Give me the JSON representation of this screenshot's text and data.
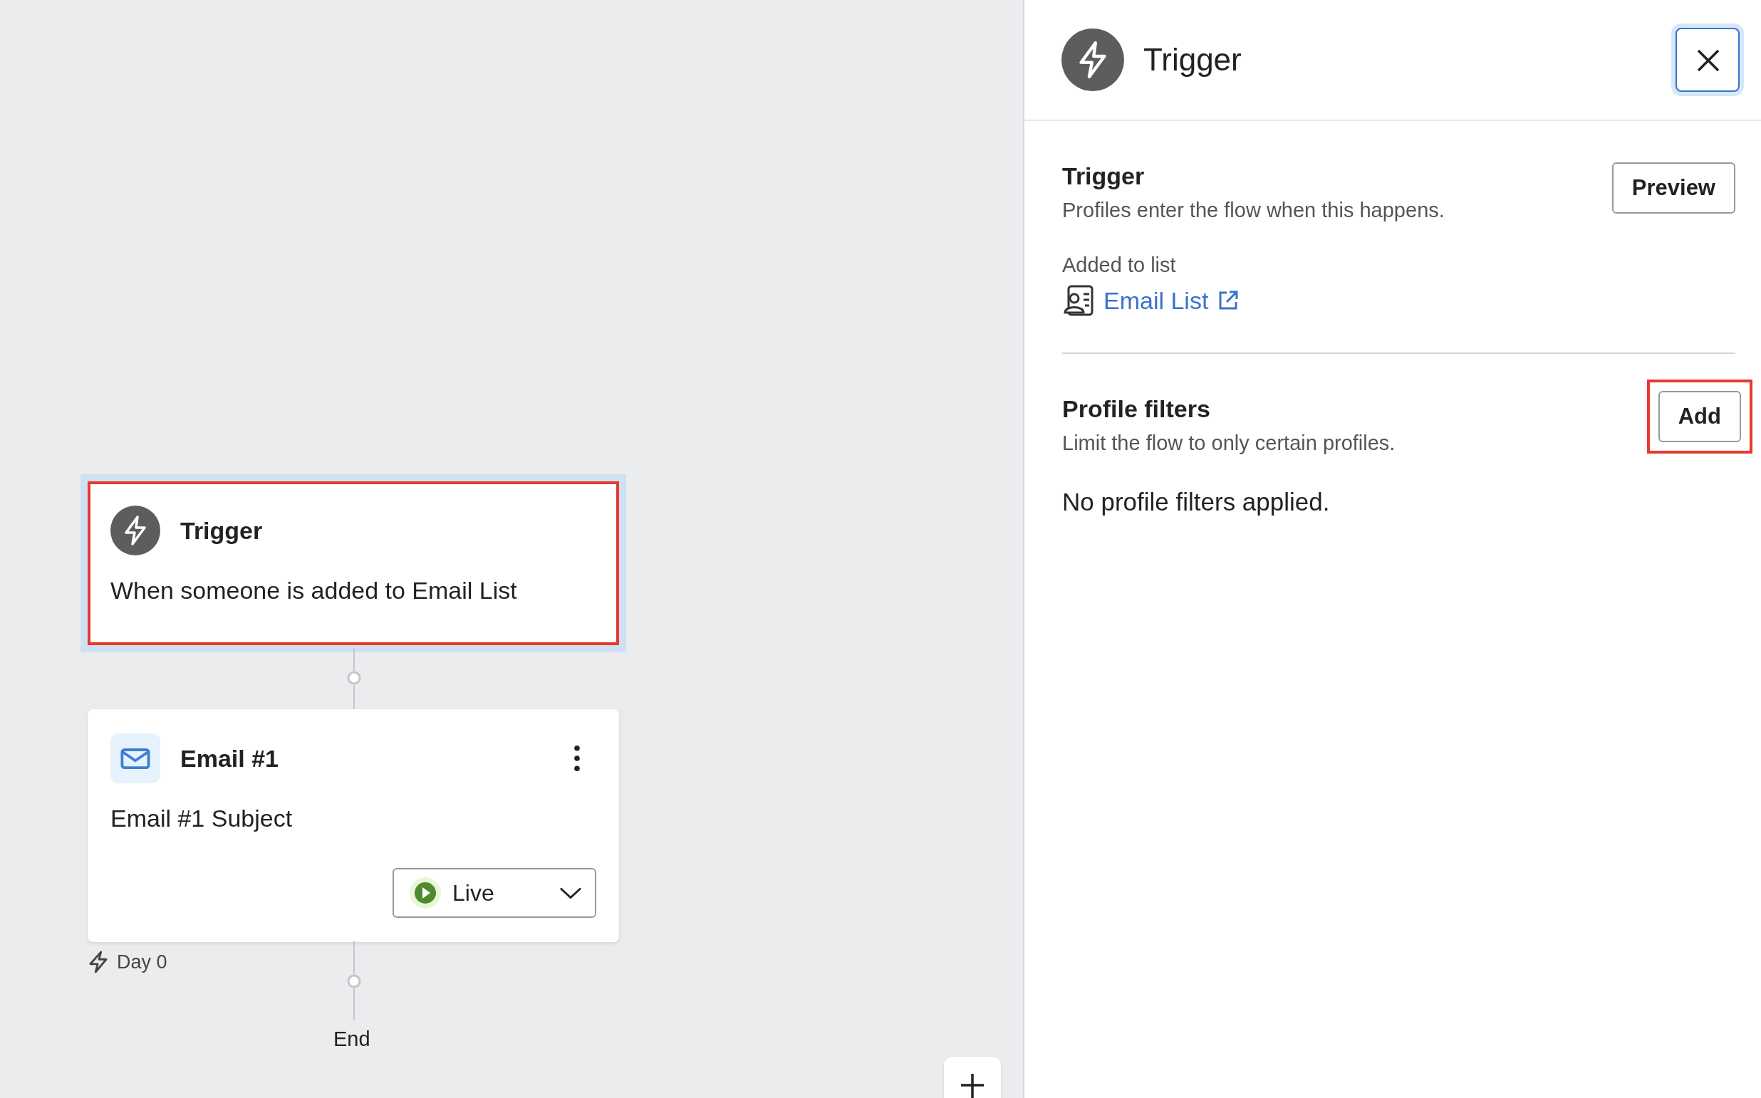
{
  "canvas": {
    "nodes": [
      {
        "kind": "trigger",
        "title": "Trigger",
        "text": "When someone is added to Email List",
        "highlighted": true
      },
      {
        "kind": "email",
        "title": "Email #1",
        "text": "Email #1 Subject",
        "status": "Live",
        "highlighted": false
      }
    ],
    "delay_label": "Day 0",
    "end_label": "End"
  },
  "panel": {
    "title": "Trigger",
    "trigger_section": {
      "heading": "Trigger",
      "description": "Profiles enter the flow when this happens.",
      "button": "Preview",
      "field_label": "Added to list",
      "link": "Email List"
    },
    "filters_section": {
      "heading": "Profile filters",
      "description": "Limit the flow to only certain profiles.",
      "button": "Add",
      "button_highlighted": true,
      "empty_text": "No profile filters applied."
    }
  }
}
